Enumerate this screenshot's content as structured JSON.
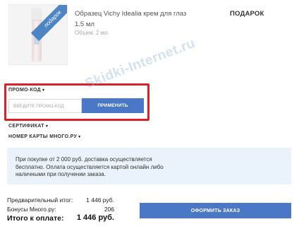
{
  "product": {
    "name": "Образец Vichy Idealia крем для глаз",
    "size": "1.5 мл",
    "volume": "Объем: 2 мл.",
    "ribbon": "подарок",
    "gift_label": "ПОДАРОК"
  },
  "promo": {
    "toggle_label": "ПРОМО-КОД",
    "input_placeholder": "ВВЕДИТЕ ПРОМО-КОД",
    "input_value": "",
    "apply_label": "ПРИМЕНИТЬ"
  },
  "certificate": {
    "toggle_label": "СЕРТИФИКАТ"
  },
  "loyalty_card": {
    "toggle_label": "НОМЕР КАРТЫ МНОГО.РУ"
  },
  "info": {
    "text": "При покупке от 2 000 руб. доставка осуществляется бесплатно. Оплата осуществляется картой онлайн либо наличными при получении заказа."
  },
  "watermark": "Skidki-Internet.ru",
  "summary": {
    "subtotal_label": "Предварительный итог:",
    "subtotal_value": "1 446 руб.",
    "bonus_label": "Бонусы Много.ру:",
    "bonus_value": "206",
    "total_label": "Итого к оплате:",
    "total_value": "1 446 руб."
  },
  "checkout": {
    "button_label": "ОФОРМИТЬ ЗАКАЗ"
  },
  "colors": {
    "accent_blue": "#4a77c6",
    "highlight_red": "#d92127",
    "info_bg": "#eaf3fb"
  }
}
